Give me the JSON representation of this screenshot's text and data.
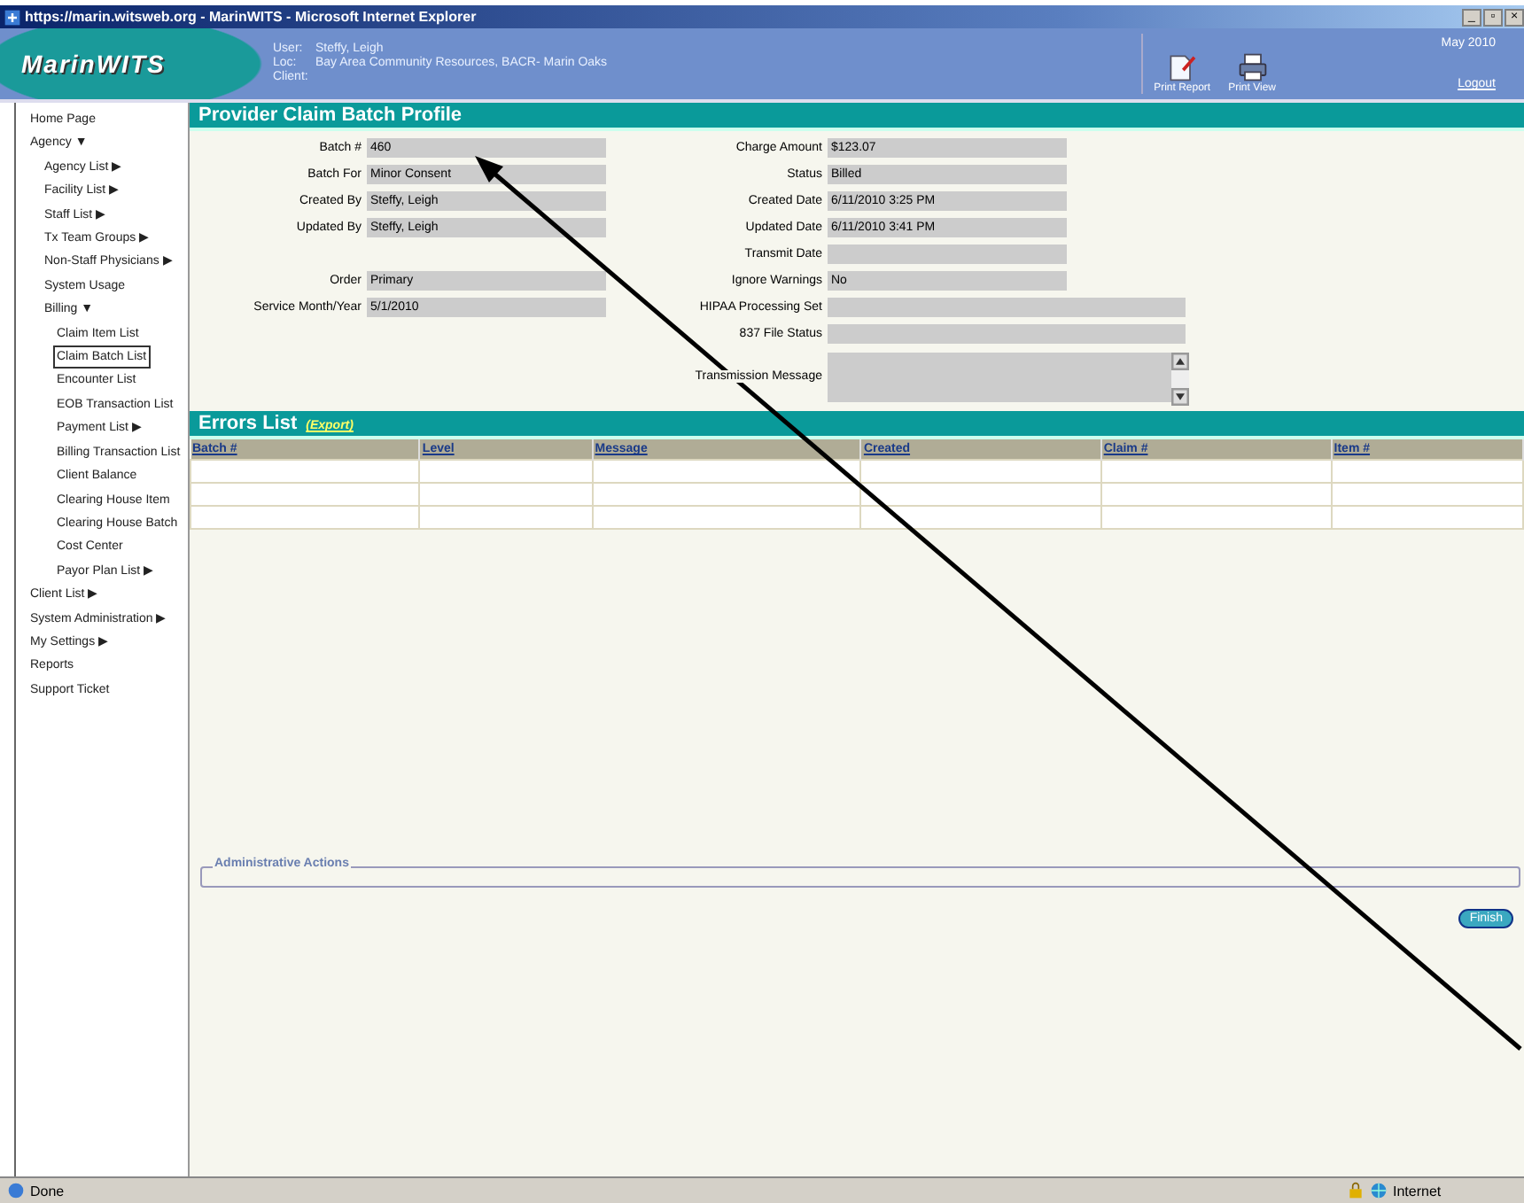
{
  "window": {
    "title": "https://marin.witsweb.org - MarinWITS - Microsoft Internet Explorer",
    "controls": [
      "_",
      "▫",
      "×"
    ]
  },
  "header": {
    "logo": "MarinWITS",
    "info": [
      {
        "label": "User:",
        "value": "Steffy, Leigh"
      },
      {
        "label": "Loc:",
        "value": "Bay Area Community Resources, BACR- Marin Oaks"
      },
      {
        "label": "Client:"
      }
    ],
    "tools": [
      {
        "kind": "report",
        "label": "Print Report"
      },
      {
        "kind": "print",
        "label": "Print View"
      }
    ],
    "date": "May 2010",
    "logout": "Logout"
  },
  "sidebar": {
    "items": [
      {
        "label": "Home Page",
        "selected": false
      },
      {
        "label": "Agency",
        "marker": "▼",
        "selected": false,
        "children": [
          {
            "label": "Agency List",
            "marker": "▶",
            "selected": false
          },
          {
            "label": "Facility List",
            "marker": "▶",
            "selected": false
          },
          {
            "label": "Staff List",
            "marker": "▶",
            "selected": false
          },
          {
            "label": "Tx Team Groups",
            "marker": "▶",
            "selected": false
          },
          {
            "label": "Non-Staff Physicians",
            "marker": "▶",
            "selected": false
          },
          {
            "label": "System Usage",
            "selected": false
          },
          {
            "label": "Billing",
            "marker": "▼",
            "selected": false,
            "children": [
              {
                "label": "Claim Item List",
                "selected": false
              },
              {
                "label": "Claim Batch List",
                "selected": true
              },
              {
                "label": "Encounter List",
                "selected": false
              },
              {
                "label": "EOB Transaction List",
                "selected": false
              },
              {
                "label": "Payment List",
                "marker": "▶",
                "selected": false
              },
              {
                "label": "Billing Transaction List",
                "selected": false
              },
              {
                "label": "Client Balance",
                "selected": false
              },
              {
                "label": "Clearing House Item",
                "selected": false
              },
              {
                "label": "Clearing House Batch",
                "selected": false
              },
              {
                "label": "Cost Center",
                "selected": false
              },
              {
                "label": "Payor Plan List",
                "marker": "▶",
                "selected": false
              }
            ]
          }
        ]
      },
      {
        "label": "Client List",
        "marker": "▶",
        "selected": false
      },
      {
        "label": "System Administration",
        "marker": "▶",
        "selected": false
      },
      {
        "label": "My Settings",
        "marker": "▶",
        "selected": false
      },
      {
        "label": "Reports",
        "selected": false
      },
      {
        "label": "Support Ticket",
        "selected": false
      }
    ]
  },
  "profile": {
    "title": "Provider Claim Batch Profile",
    "rows": [
      {
        "left": {
          "label": "Batch #",
          "value": "460"
        },
        "right": {
          "label": "Charge Amount",
          "value": "$123.07",
          "kind": "short"
        }
      },
      {
        "left": {
          "label": "Batch For",
          "value": "Minor Consent"
        },
        "right": {
          "label": "Status",
          "value": "Billed",
          "kind": "short"
        }
      },
      {
        "left": {
          "label": "Created By",
          "value": "Steffy, Leigh"
        },
        "right": {
          "label": "Created Date",
          "value": "6/11/2010 3:25 PM",
          "kind": "short"
        }
      },
      {
        "left": {
          "label": "Updated By",
          "value": "Steffy, Leigh"
        },
        "right": {
          "label": "Updated Date",
          "value": "6/11/2010 3:41 PM",
          "kind": "short"
        }
      },
      {
        "right": {
          "label": "Transmit Date",
          "kind": "short"
        }
      },
      {
        "left": {
          "label": "Order",
          "value": "Primary"
        },
        "right": {
          "label": "Ignore Warnings",
          "value": "No",
          "kind": "short"
        }
      },
      {
        "left": {
          "label": "Service Month/Year",
          "value": "5/1/2010"
        },
        "right": {
          "label": "HIPAA Processing Set",
          "kind": "wide"
        }
      },
      {
        "right": {
          "label": "837 File Status",
          "kind": "wide"
        }
      },
      {
        "right": {
          "label": "Transmission Message",
          "kind": "textarea"
        }
      }
    ]
  },
  "errors": {
    "title": "Errors List",
    "export": "(Export)",
    "columns": [
      "Batch #",
      "Level",
      "Message",
      "Created",
      "Claim #",
      "Item #"
    ]
  },
  "admin": {
    "legend": "Administrative Actions"
  },
  "finish": "Finish",
  "status_bar": {
    "text": "Done",
    "zone": "Internet"
  }
}
